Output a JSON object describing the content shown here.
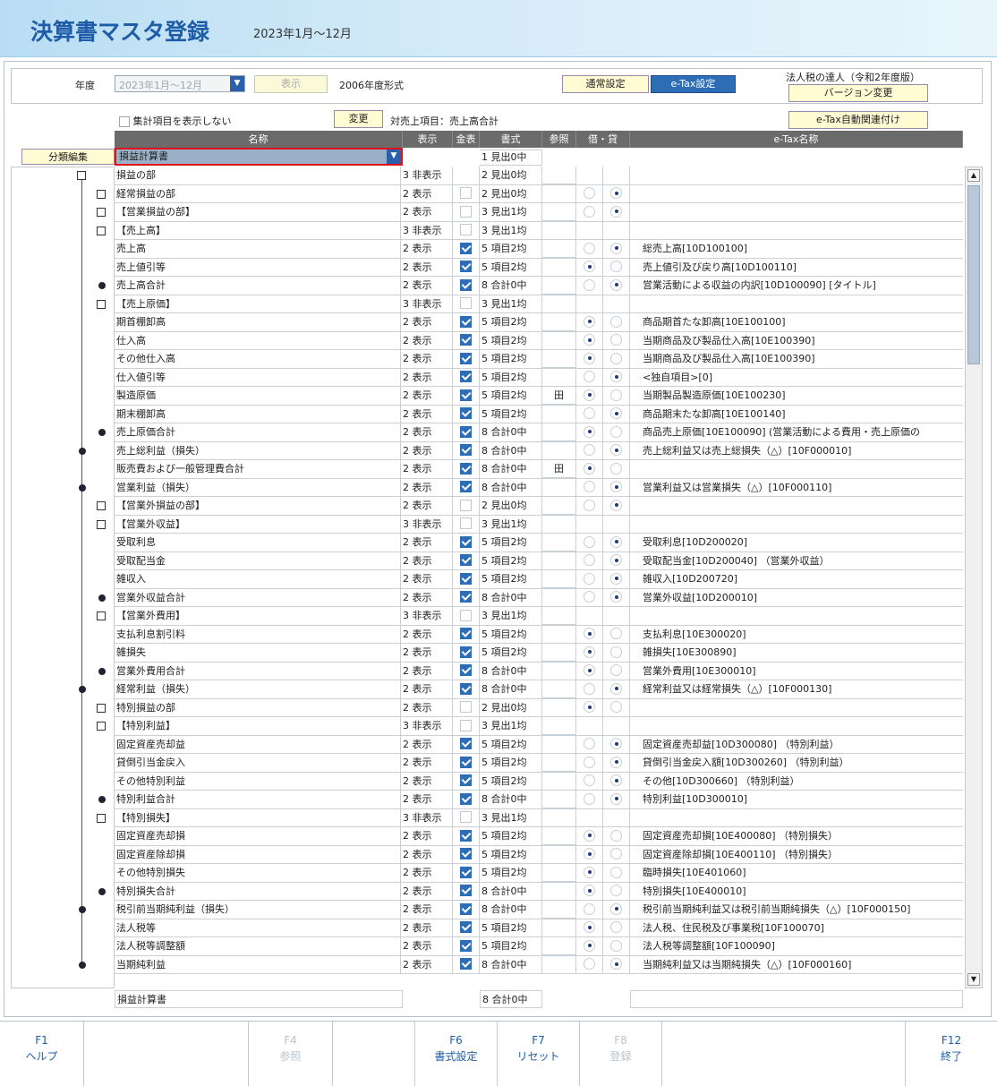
{
  "header": {
    "title": "決算書マスタ登録",
    "period": "2023年1月～12月"
  },
  "top": {
    "year_label": "年度",
    "year_value": "2023年1月～12月",
    "show_button": "表示",
    "format_note": "2006年度形式",
    "normal_settings": "通常設定",
    "etax_settings": "e-Tax設定",
    "corp_tax_label": "法人税の達人（令和2年度版）",
    "version_change": "バージョン変更",
    "hide_total_items": "集計項目を表示しない",
    "change_button": "変更",
    "target_sales": "対売上項目：売上高合計",
    "etax_auto_link": "e-Tax自動関連付け"
  },
  "columns": [
    "名称",
    "表示",
    "金表",
    "書式",
    "参照",
    "借・貸",
    "e-Tax名称"
  ],
  "category_edit": "分類編集",
  "statement_select": "損益計算書",
  "statement_format": "1 見出0中",
  "rows": [
    {
      "name": "損益の部",
      "disp": "3 非表示",
      "amt": "",
      "fmt": "2 見出0均",
      "ref": "",
      "dr": "",
      "cr": "",
      "etax": "",
      "node": "sq",
      "lvl": 0
    },
    {
      "name": "経常損益の部",
      "disp": "2 表示",
      "amt": "off",
      "fmt": "2 見出0均",
      "ref": "",
      "dr": "off",
      "cr": "on",
      "etax": "",
      "node": "sq",
      "lvl": 1
    },
    {
      "name": "【営業損益の部】",
      "disp": "2 表示",
      "amt": "off",
      "fmt": "3 見出1均",
      "ref": "",
      "dr": "off",
      "cr": "on",
      "etax": "",
      "node": "sq",
      "lvl": 1
    },
    {
      "name": "【売上高】",
      "disp": "3 非表示",
      "amt": "off",
      "fmt": "3 見出1均",
      "ref": "",
      "dr": "",
      "cr": "",
      "etax": "",
      "node": "sq",
      "lvl": 1
    },
    {
      "name": "売上高",
      "disp": "2 表示",
      "amt": "on",
      "fmt": "5 項目2均",
      "ref": "",
      "dr": "off",
      "cr": "on",
      "etax": "総売上高[10D100100]",
      "node": "",
      "lvl": 2
    },
    {
      "name": "売上値引等",
      "disp": "2 表示",
      "amt": "on",
      "fmt": "5 項目2均",
      "ref": "",
      "dr": "on",
      "cr": "off",
      "etax": "売上値引及び戻り高[10D100110]",
      "node": "",
      "lvl": 2
    },
    {
      "name": "売上高合計",
      "disp": "2 表示",
      "amt": "on",
      "fmt": "8 合計0中",
      "ref": "",
      "dr": "off",
      "cr": "on",
      "etax": "営業活動による収益の内訳[10D100090] [タイトル]",
      "node": "dot",
      "lvl": 1
    },
    {
      "name": "【売上原価】",
      "disp": "3 非表示",
      "amt": "off",
      "fmt": "3 見出1均",
      "ref": "",
      "dr": "",
      "cr": "",
      "etax": "",
      "node": "sq",
      "lvl": 1
    },
    {
      "name": "期首棚卸高",
      "disp": "2 表示",
      "amt": "on",
      "fmt": "5 項目2均",
      "ref": "",
      "dr": "on",
      "cr": "off",
      "etax": "商品期首たな卸高[10E100100]",
      "node": "",
      "lvl": 2
    },
    {
      "name": "仕入高",
      "disp": "2 表示",
      "amt": "on",
      "fmt": "5 項目2均",
      "ref": "",
      "dr": "on",
      "cr": "off",
      "etax": "当期商品及び製品仕入高[10E100390]",
      "node": "",
      "lvl": 2
    },
    {
      "name": "その他仕入高",
      "disp": "2 表示",
      "amt": "on",
      "fmt": "5 項目2均",
      "ref": "",
      "dr": "on",
      "cr": "off",
      "etax": "当期商品及び製品仕入高[10E100390]",
      "node": "",
      "lvl": 2
    },
    {
      "name": "仕入値引等",
      "disp": "2 表示",
      "amt": "on",
      "fmt": "5 項目2均",
      "ref": "",
      "dr": "off",
      "cr": "on",
      "etax": "<独自項目>[0]",
      "node": "",
      "lvl": 2
    },
    {
      "name": "製造原価",
      "disp": "2 表示",
      "amt": "on",
      "fmt": "5 項目2均",
      "ref": "田",
      "dr": "on",
      "cr": "off",
      "etax": "当期製品製造原価[10E100230]",
      "node": "",
      "lvl": 2
    },
    {
      "name": "期末棚卸高",
      "disp": "2 表示",
      "amt": "on",
      "fmt": "5 項目2均",
      "ref": "",
      "dr": "off",
      "cr": "on",
      "etax": "商品期末たな卸高[10E100140]",
      "node": "",
      "lvl": 2
    },
    {
      "name": "売上原価合計",
      "disp": "2 表示",
      "amt": "on",
      "fmt": "8 合計0中",
      "ref": "",
      "dr": "on",
      "cr": "off",
      "etax": "商品売上原価[10E100090] (営業活動による費用・売上原価の",
      "node": "dot",
      "lvl": 1
    },
    {
      "name": "売上総利益（損失）",
      "disp": "2 表示",
      "amt": "on",
      "fmt": "8 合計0中",
      "ref": "",
      "dr": "off",
      "cr": "on",
      "etax": "売上総利益又は売上総損失（△）[10F000010]",
      "node": "dot",
      "lvl": 0
    },
    {
      "name": "販売費および一般管理費合計",
      "disp": "2 表示",
      "amt": "on",
      "fmt": "8 合計0中",
      "ref": "田",
      "dr": "on",
      "cr": "off",
      "etax": "",
      "node": "",
      "lvl": 0
    },
    {
      "name": "営業利益（損失）",
      "disp": "2 表示",
      "amt": "on",
      "fmt": "8 合計0中",
      "ref": "",
      "dr": "off",
      "cr": "on",
      "etax": "営業利益又は営業損失（△）[10F000110]",
      "node": "dot",
      "lvl": 0
    },
    {
      "name": "【営業外損益の部】",
      "disp": "2 表示",
      "amt": "off",
      "fmt": "2 見出0均",
      "ref": "",
      "dr": "off",
      "cr": "on",
      "etax": "",
      "node": "sq",
      "lvl": 1
    },
    {
      "name": "【営業外収益】",
      "disp": "3 非表示",
      "amt": "off",
      "fmt": "3 見出1均",
      "ref": "",
      "dr": "",
      "cr": "",
      "etax": "",
      "node": "sq",
      "lvl": 1
    },
    {
      "name": "受取利息",
      "disp": "2 表示",
      "amt": "on",
      "fmt": "5 項目2均",
      "ref": "",
      "dr": "off",
      "cr": "on",
      "etax": "受取利息[10D200020]",
      "node": "",
      "lvl": 2
    },
    {
      "name": "受取配当金",
      "disp": "2 表示",
      "amt": "on",
      "fmt": "5 項目2均",
      "ref": "",
      "dr": "off",
      "cr": "on",
      "etax": "受取配当金[10D200040] （営業外収益）",
      "node": "",
      "lvl": 2
    },
    {
      "name": "雑収入",
      "disp": "2 表示",
      "amt": "on",
      "fmt": "5 項目2均",
      "ref": "",
      "dr": "off",
      "cr": "on",
      "etax": "雑収入[10D200720]",
      "node": "",
      "lvl": 2
    },
    {
      "name": "営業外収益合計",
      "disp": "2 表示",
      "amt": "on",
      "fmt": "8 合計0中",
      "ref": "",
      "dr": "off",
      "cr": "on",
      "etax": "営業外収益[10D200010]",
      "node": "dot",
      "lvl": 1
    },
    {
      "name": "【営業外費用】",
      "disp": "3 非表示",
      "amt": "off",
      "fmt": "3 見出1均",
      "ref": "",
      "dr": "",
      "cr": "",
      "etax": "",
      "node": "sq",
      "lvl": 1
    },
    {
      "name": "支払利息割引料",
      "disp": "2 表示",
      "amt": "on",
      "fmt": "5 項目2均",
      "ref": "",
      "dr": "on",
      "cr": "off",
      "etax": "支払利息[10E300020]",
      "node": "",
      "lvl": 2
    },
    {
      "name": "雑損失",
      "disp": "2 表示",
      "amt": "on",
      "fmt": "5 項目2均",
      "ref": "",
      "dr": "on",
      "cr": "off",
      "etax": "雑損失[10E300890]",
      "node": "",
      "lvl": 2
    },
    {
      "name": "営業外費用合計",
      "disp": "2 表示",
      "amt": "on",
      "fmt": "8 合計0中",
      "ref": "",
      "dr": "on",
      "cr": "off",
      "etax": "営業外費用[10E300010]",
      "node": "dot",
      "lvl": 1
    },
    {
      "name": "経常利益（損失）",
      "disp": "2 表示",
      "amt": "on",
      "fmt": "8 合計0中",
      "ref": "",
      "dr": "off",
      "cr": "on",
      "etax": "経常利益又は経常損失（△）[10F000130]",
      "node": "dot",
      "lvl": 0
    },
    {
      "name": "特別損益の部",
      "disp": "2 表示",
      "amt": "off",
      "fmt": "2 見出0均",
      "ref": "",
      "dr": "on",
      "cr": "off",
      "etax": "",
      "node": "sq",
      "lvl": 1
    },
    {
      "name": "【特別利益】",
      "disp": "3 非表示",
      "amt": "off",
      "fmt": "3 見出1均",
      "ref": "",
      "dr": "",
      "cr": "",
      "etax": "",
      "node": "sq",
      "lvl": 1
    },
    {
      "name": "固定資産売却益",
      "disp": "2 表示",
      "amt": "on",
      "fmt": "5 項目2均",
      "ref": "",
      "dr": "off",
      "cr": "on",
      "etax": "固定資産売却益[10D300080] （特別利益）",
      "node": "",
      "lvl": 2
    },
    {
      "name": "貸倒引当金戻入",
      "disp": "2 表示",
      "amt": "on",
      "fmt": "5 項目2均",
      "ref": "",
      "dr": "off",
      "cr": "on",
      "etax": "貸倒引当金戻入額[10D300260] （特別利益）",
      "node": "",
      "lvl": 2
    },
    {
      "name": "その他特別利益",
      "disp": "2 表示",
      "amt": "on",
      "fmt": "5 項目2均",
      "ref": "",
      "dr": "off",
      "cr": "on",
      "etax": "その他[10D300660] （特別利益）",
      "node": "",
      "lvl": 2
    },
    {
      "name": "特別利益合計",
      "disp": "2 表示",
      "amt": "on",
      "fmt": "8 合計0中",
      "ref": "",
      "dr": "off",
      "cr": "on",
      "etax": "特別利益[10D300010]",
      "node": "dot",
      "lvl": 1
    },
    {
      "name": "【特別損失】",
      "disp": "3 非表示",
      "amt": "off",
      "fmt": "3 見出1均",
      "ref": "",
      "dr": "",
      "cr": "",
      "etax": "",
      "node": "sq",
      "lvl": 1
    },
    {
      "name": "固定資産売却損",
      "disp": "2 表示",
      "amt": "on",
      "fmt": "5 項目2均",
      "ref": "",
      "dr": "on",
      "cr": "off",
      "etax": "固定資産売却損[10E400080] （特別損失）",
      "node": "",
      "lvl": 2
    },
    {
      "name": "固定資産除却損",
      "disp": "2 表示",
      "amt": "on",
      "fmt": "5 項目2均",
      "ref": "",
      "dr": "on",
      "cr": "off",
      "etax": "固定資産除却損[10E400110] （特別損失）",
      "node": "",
      "lvl": 2
    },
    {
      "name": "その他特別損失",
      "disp": "2 表示",
      "amt": "on",
      "fmt": "5 項目2均",
      "ref": "",
      "dr": "on",
      "cr": "off",
      "etax": "臨時損失[10E401060]",
      "node": "",
      "lvl": 2
    },
    {
      "name": "特別損失合計",
      "disp": "2 表示",
      "amt": "on",
      "fmt": "8 合計0中",
      "ref": "",
      "dr": "on",
      "cr": "off",
      "etax": "特別損失[10E400010]",
      "node": "dot",
      "lvl": 1
    },
    {
      "name": "税引前当期純利益（損失）",
      "disp": "2 表示",
      "amt": "on",
      "fmt": "8 合計0中",
      "ref": "",
      "dr": "off",
      "cr": "on",
      "etax": "税引前当期純利益又は税引前当期純損失（△）[10F000150]",
      "node": "dot",
      "lvl": 0
    },
    {
      "name": "法人税等",
      "disp": "2 表示",
      "amt": "on",
      "fmt": "5 項目2均",
      "ref": "",
      "dr": "on",
      "cr": "off",
      "etax": "法人税、住民税及び事業税[10F100070]",
      "node": "",
      "lvl": 1
    },
    {
      "name": "法人税等調整額",
      "disp": "2 表示",
      "amt": "on",
      "fmt": "5 項目2均",
      "ref": "",
      "dr": "on",
      "cr": "off",
      "etax": "法人税等調整額[10F100090]",
      "node": "",
      "lvl": 1
    },
    {
      "name": "当期純利益",
      "disp": "2 表示",
      "amt": "on",
      "fmt": "8 合計0中",
      "ref": "",
      "dr": "off",
      "cr": "on",
      "etax": "当期純利益又は当期純損失（△）[10F000160]",
      "node": "dot",
      "lvl": 0
    }
  ],
  "footer_row": {
    "name": "損益計算書",
    "fmt": "8 合計0中"
  },
  "fkeys": [
    {
      "key": "F1",
      "label": "ヘルプ",
      "enabled": true
    },
    {
      "key": "",
      "label": "",
      "enabled": false
    },
    {
      "key": "F4",
      "label": "参照",
      "enabled": false
    },
    {
      "key": "",
      "label": "",
      "enabled": false
    },
    {
      "key": "F6",
      "label": "書式設定",
      "enabled": true
    },
    {
      "key": "F7",
      "label": "リセット",
      "enabled": true
    },
    {
      "key": "F8",
      "label": "登録",
      "enabled": false
    },
    {
      "key": "",
      "label": "",
      "enabled": false
    },
    {
      "key": "F12",
      "label": "終了",
      "enabled": true
    }
  ],
  "colors": {
    "accent": "#2d6db5",
    "highlight": "#e0101a",
    "header_gray": "#6b6b6b",
    "button_yellow": "#fffbd3"
  }
}
